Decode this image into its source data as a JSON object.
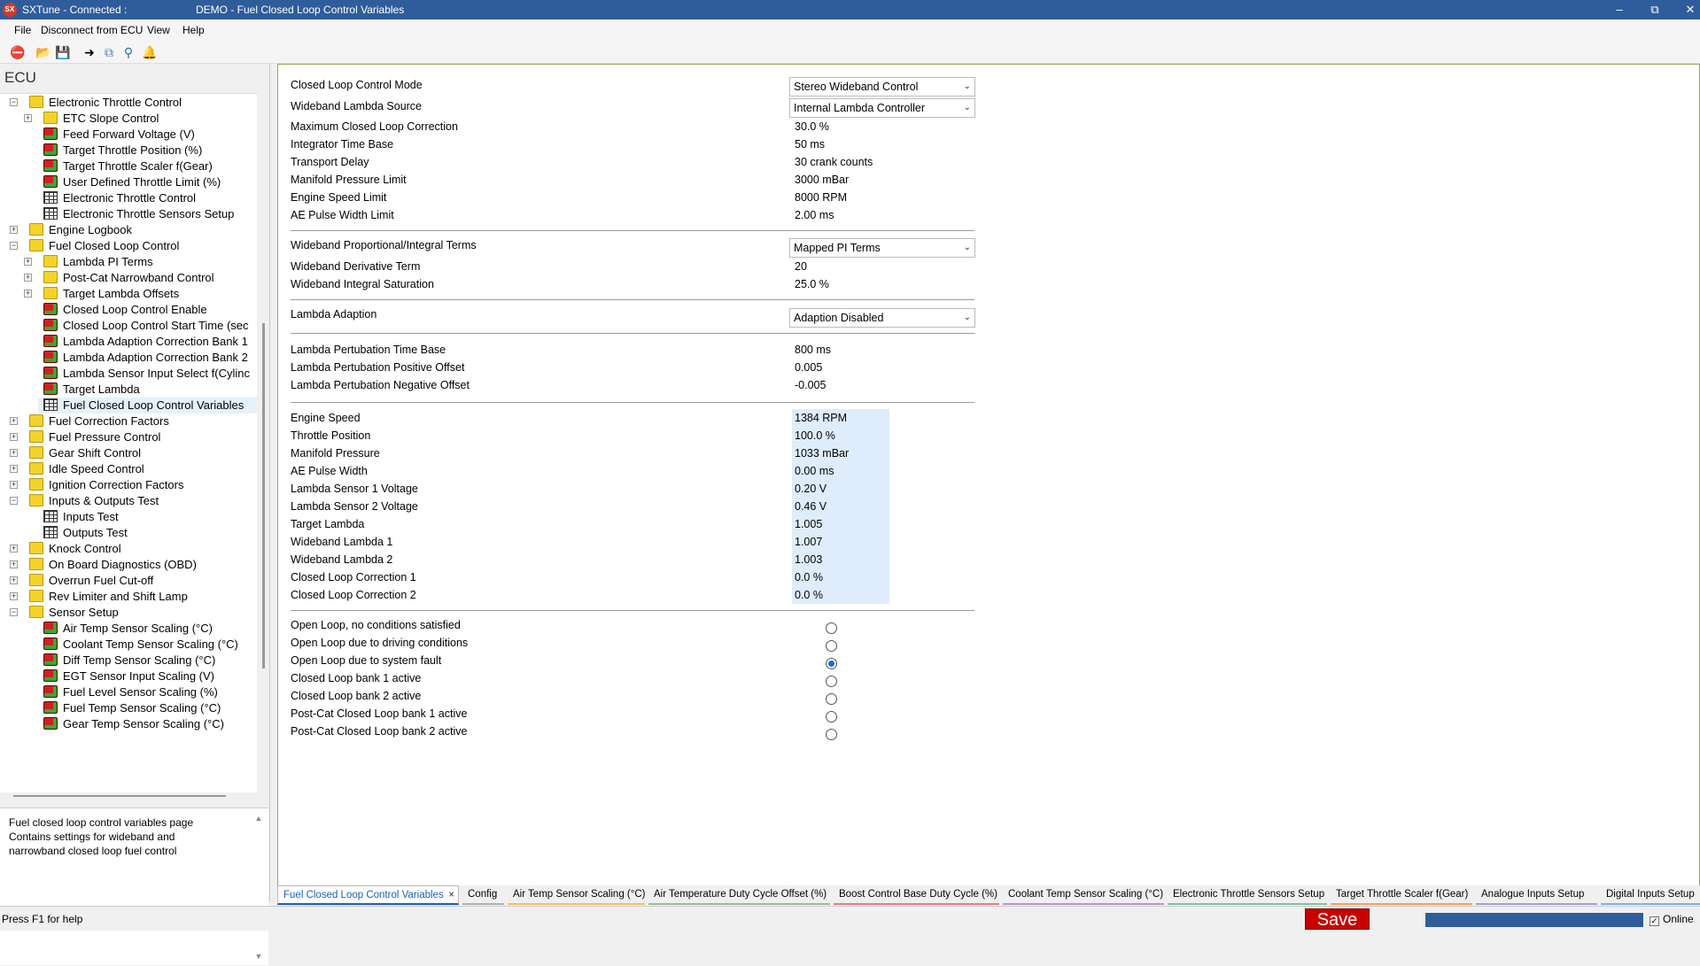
{
  "window": {
    "app_title": "SXTune - Connected :",
    "doc_title": "DEMO - Fuel Closed Loop Control Variables",
    "app_icon": "SX",
    "controls": [
      "minimize-icon",
      "restore-icon",
      "close-icon"
    ]
  },
  "menu": [
    "File",
    "Disconnect from ECU",
    "View",
    "Help"
  ],
  "toolbar": [
    "disconnect-icon",
    "open-folder-icon",
    "save-icon",
    "goto-icon",
    "copy-icon",
    "search-icon",
    "alert-bell-icon"
  ],
  "sidebar": {
    "heading": "ECU",
    "tree": [
      {
        "label": "Electronic Throttle Control",
        "type": "folder",
        "level": 0,
        "exp": "−"
      },
      {
        "label": "ETC Slope Control",
        "type": "folder",
        "level": 1,
        "exp": "+"
      },
      {
        "label": "Feed Forward Voltage (V)",
        "type": "cube",
        "level": 1
      },
      {
        "label": "Target Throttle Position (%)",
        "type": "cube",
        "level": 1
      },
      {
        "label": "Target Throttle Scaler f(Gear)",
        "type": "cube",
        "level": 1
      },
      {
        "label": "User Defined Throttle Limit (%)",
        "type": "cube",
        "level": 1
      },
      {
        "label": "Electronic Throttle Control",
        "type": "grid",
        "level": 1
      },
      {
        "label": "Electronic Throttle Sensors Setup",
        "type": "grid",
        "level": 1
      },
      {
        "label": "Engine Logbook",
        "type": "folder",
        "level": 0,
        "exp": "+"
      },
      {
        "label": "Fuel Closed Loop Control",
        "type": "folder",
        "level": 0,
        "exp": "−"
      },
      {
        "label": "Lambda PI Terms",
        "type": "folder",
        "level": 1,
        "exp": "+"
      },
      {
        "label": "Post-Cat Narrowband Control",
        "type": "folder",
        "level": 1,
        "exp": "+"
      },
      {
        "label": "Target Lambda Offsets",
        "type": "folder",
        "level": 1,
        "exp": "+"
      },
      {
        "label": "Closed Loop Control Enable",
        "type": "cube",
        "level": 1
      },
      {
        "label": "Closed Loop Control Start Time (sec",
        "type": "cube",
        "level": 1
      },
      {
        "label": "Lambda Adaption Correction Bank 1",
        "type": "cube",
        "level": 1
      },
      {
        "label": "Lambda Adaption Correction Bank 2",
        "type": "cube",
        "level": 1
      },
      {
        "label": "Lambda Sensor Input Select f(Cylinc",
        "type": "cube",
        "level": 1
      },
      {
        "label": "Target Lambda",
        "type": "cube",
        "level": 1
      },
      {
        "label": "Fuel Closed Loop Control Variables",
        "type": "grid",
        "level": 1,
        "selected": true
      },
      {
        "label": "Fuel Correction Factors",
        "type": "folder",
        "level": 0,
        "exp": "+"
      },
      {
        "label": "Fuel Pressure Control",
        "type": "folder",
        "level": 0,
        "exp": "+"
      },
      {
        "label": "Gear Shift Control",
        "type": "folder",
        "level": 0,
        "exp": "+"
      },
      {
        "label": "Idle Speed Control",
        "type": "folder",
        "level": 0,
        "exp": "+"
      },
      {
        "label": "Ignition Correction Factors",
        "type": "folder",
        "level": 0,
        "exp": "+"
      },
      {
        "label": "Inputs & Outputs Test",
        "type": "folder",
        "level": 0,
        "exp": "−"
      },
      {
        "label": "Inputs Test",
        "type": "grid",
        "level": 1
      },
      {
        "label": "Outputs Test",
        "type": "grid",
        "level": 1
      },
      {
        "label": "Knock Control",
        "type": "folder",
        "level": 0,
        "exp": "+"
      },
      {
        "label": "On Board Diagnostics (OBD)",
        "type": "folder",
        "level": 0,
        "exp": "+"
      },
      {
        "label": "Overrun Fuel Cut-off",
        "type": "folder",
        "level": 0,
        "exp": "+"
      },
      {
        "label": "Rev Limiter and Shift Lamp",
        "type": "folder",
        "level": 0,
        "exp": "+"
      },
      {
        "label": "Sensor Setup",
        "type": "folder",
        "level": 0,
        "exp": "−"
      },
      {
        "label": "Air Temp Sensor Scaling (°C)",
        "type": "cube",
        "level": 1
      },
      {
        "label": "Coolant Temp Sensor Scaling (°C)",
        "type": "cube",
        "level": 1
      },
      {
        "label": "Diff Temp Sensor Scaling (°C)",
        "type": "cube",
        "level": 1
      },
      {
        "label": "EGT Sensor Input Scaling (V)",
        "type": "cube",
        "level": 1
      },
      {
        "label": "Fuel Level Sensor Scaling (%)",
        "type": "cube",
        "level": 1
      },
      {
        "label": "Fuel Temp Sensor Scaling (°C)",
        "type": "cube",
        "level": 1
      },
      {
        "label": "Gear Temp Sensor Scaling (°C)",
        "type": "cube",
        "level": 1
      }
    ],
    "description": [
      "Fuel closed loop control variables page",
      "Contains settings for wideband and",
      "narrowband closed loop fuel control"
    ]
  },
  "main": {
    "dropdowns": {
      "closed_loop_mode": {
        "label": "Closed Loop Control Mode",
        "value": "Stereo Wideband Control"
      },
      "wideband_source": {
        "label": "Wideband Lambda Source",
        "value": "Internal Lambda Controller"
      },
      "pi_terms": {
        "label": "Wideband Proportional/Integral Terms",
        "value": "Mapped PI Terms"
      },
      "lambda_adaption": {
        "label": "Lambda Adaption",
        "value": "Adaption Disabled"
      }
    },
    "limits": [
      {
        "label": "Maximum Closed Loop Correction",
        "value": "30.0 %"
      },
      {
        "label": "Integrator Time Base",
        "value": "50 ms"
      },
      {
        "label": "Transport Delay",
        "value": "30 crank counts"
      },
      {
        "label": "Manifold Pressure Limit",
        "value": "3000 mBar"
      },
      {
        "label": "Engine Speed Limit",
        "value": "8000 RPM"
      },
      {
        "label": "AE Pulse Width Limit",
        "value": "2.00 ms"
      }
    ],
    "wideband_terms": [
      {
        "label": "Wideband Derivative Term",
        "value": "20"
      },
      {
        "label": "Wideband Integral Saturation",
        "value": "25.0 %"
      }
    ],
    "perturbation": [
      {
        "label": "Lambda Pertubation Time Base",
        "value": "800 ms"
      },
      {
        "label": "Lambda Pertubation Positive Offset",
        "value": "0.005"
      },
      {
        "label": "Lambda Pertubation Negative Offset",
        "value": "-0.005"
      }
    ],
    "live": [
      {
        "label": "Engine Speed",
        "value": "1384 RPM"
      },
      {
        "label": "Throttle Position",
        "value": "100.0 %"
      },
      {
        "label": "Manifold Pressure",
        "value": "1033 mBar"
      },
      {
        "label": "AE Pulse Width",
        "value": "0.00 ms"
      },
      {
        "label": "Lambda Sensor 1 Voltage",
        "value": "0.20 V"
      },
      {
        "label": "Lambda Sensor 2 Voltage",
        "value": "0.46 V"
      },
      {
        "label": "Target Lambda",
        "value": "1.005"
      },
      {
        "label": "Wideband Lambda 1",
        "value": "1.007"
      },
      {
        "label": "Wideband Lambda 2",
        "value": "1.003"
      },
      {
        "label": "Closed Loop Correction 1",
        "value": "0.0 %"
      },
      {
        "label": "Closed Loop Correction 2",
        "value": "0.0 %"
      }
    ],
    "status_radios": [
      {
        "label": "Open Loop, no conditions satisfied",
        "checked": false
      },
      {
        "label": "Open Loop due to driving conditions",
        "checked": false
      },
      {
        "label": "Open Loop due to system fault",
        "checked": true
      },
      {
        "label": "Closed Loop bank 1 active",
        "checked": false
      },
      {
        "label": "Closed Loop bank 2 active",
        "checked": false
      },
      {
        "label": "Post-Cat Closed Loop bank 1 active",
        "checked": false
      },
      {
        "label": "Post-Cat Closed Loop bank 2 active",
        "checked": false
      }
    ]
  },
  "tabs": [
    {
      "label": "Fuel Closed Loop Control Variables",
      "active": true,
      "color": "#1a5fb4"
    },
    {
      "label": "Config",
      "color": "#b0b0b0"
    },
    {
      "label": "Air Temp Sensor Scaling (°C)",
      "color": "#f0c060"
    },
    {
      "label": "Air Temperature Duty Cycle Offset (%)",
      "color": "#90c090"
    },
    {
      "label": "Boost Control Base Duty Cycle (%)",
      "color": "#e08080"
    },
    {
      "label": "Coolant Temp Sensor Scaling (°C)",
      "color": "#c090d0"
    },
    {
      "label": "Electronic Throttle Sensors Setup",
      "color": "#80c0a0"
    },
    {
      "label": "Target Throttle Scaler f(Gear)",
      "color": "#f0a060"
    },
    {
      "label": "Analogue Inputs Setup",
      "color": "#a0a0e0"
    },
    {
      "label": "Digital Inputs Setup",
      "color": "#80b0e0"
    }
  ],
  "tab_close_icon": "×",
  "status": {
    "help": "Press F1 for help",
    "save_label": "Save",
    "online_label": "Online",
    "online_checked": true
  }
}
